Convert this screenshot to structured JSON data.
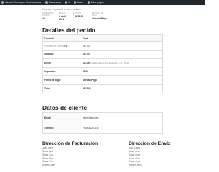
{
  "adminbar": {
    "site": "Mercado Envios para WooCommerce",
    "customize": "Personalizar",
    "comments": "0",
    "new": "Nuevo",
    "edit": "Editar página"
  },
  "order": {
    "thanks": "Gracias. Tu pedido ha sido recibido.",
    "summary": [
      {
        "label": "Número de pedido:",
        "value": "49"
      },
      {
        "label": "Fecha:",
        "value": "6 abril, 2016"
      },
      {
        "label": "Total:",
        "value": "$272.35"
      },
      {
        "label": "Método de pago:",
        "value": "MercadoPago"
      }
    ]
  },
  "details": {
    "title": "Detalles del pedido",
    "col_product": "Producto",
    "col_total": "Total",
    "product_name": "Producto de prueba",
    "product_qty": "× 1",
    "product_total": "$57.00",
    "rows": [
      {
        "label": "Subtotal:",
        "value": "$57.00",
        "note": ""
      },
      {
        "label": "Envío:",
        "value": "$211.95",
        "note": "vía Mercado Envíos (Estándar) — 4 a 5 días"
      },
      {
        "label": "Impuestos:",
        "value": "$3.50",
        "note": ""
      },
      {
        "label": "Forma de pago:",
        "value": "MercadoPago",
        "note": ""
      },
      {
        "label": "Total:",
        "value": "$272.35",
        "note": ""
      }
    ]
  },
  "client": {
    "title": "Datos de cliente",
    "rows": [
      {
        "label": "Email:",
        "value": "info@4gen.com"
      },
      {
        "label": "Teléfono:",
        "value": "+5491122011151"
      }
    ]
  },
  "billing": {
    "title": "Dirección de Facturación",
    "lines": [
      "Juan López",
      "Santa Cruz",
      "Santa Cruz",
      "Santa Cruz",
      "Santa Cruz",
      "Buenos Aires"
    ]
  },
  "shipping": {
    "title": "Dirección de Envío",
    "lines": [
      "Juan López",
      "Santa Cruz",
      "Santa Cruz",
      "Santa Cruz",
      "Santa Cruz",
      "Buenos Aires"
    ]
  }
}
